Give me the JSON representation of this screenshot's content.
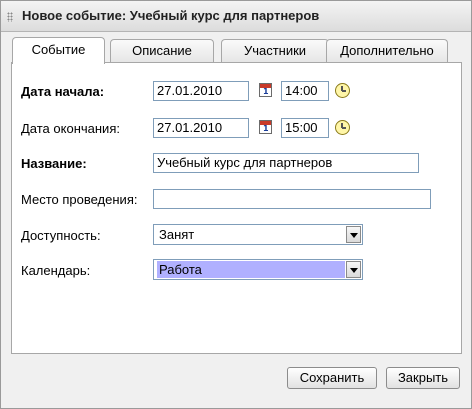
{
  "window": {
    "title": "Новое событие: Учебный курс для партнеров"
  },
  "tabs": [
    {
      "label": "Событие",
      "active": true
    },
    {
      "label": "Описание",
      "active": false
    },
    {
      "label": "Участники",
      "active": false
    },
    {
      "label": "Дополнительно",
      "active": false
    }
  ],
  "form": {
    "start": {
      "label": "Дата начала:",
      "date": "27.01.2010",
      "time": "14:00"
    },
    "end": {
      "label": "Дата окончания:",
      "date": "27.01.2010",
      "time": "15:00"
    },
    "name": {
      "label": "Название:",
      "value": "Учебный курс для партнеров"
    },
    "location": {
      "label": "Место проведения:",
      "value": ""
    },
    "availability": {
      "label": "Доступность:",
      "value": "Занят"
    },
    "calendar": {
      "label": "Календарь:",
      "value": "Работа"
    },
    "calendar_icon_text": "1"
  },
  "buttons": {
    "save": "Сохранить",
    "close": "Закрыть"
  },
  "icons": {
    "calendar": "calendar-icon",
    "clock": "clock-icon",
    "grip": "drag-grip-icon"
  },
  "colors": {
    "selection": "#b0b0ff",
    "input_border": "#7f9db9"
  }
}
